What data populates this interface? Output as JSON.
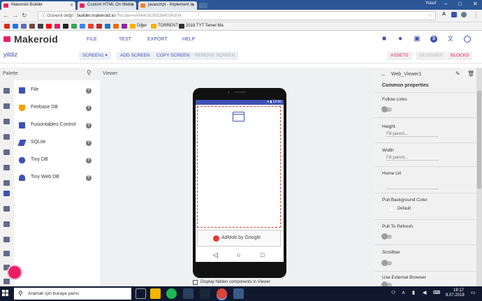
{
  "browser": {
    "tabs": [
      {
        "title": "Makeroid Builder",
        "favicon_color": "#e91e63",
        "active": true
      },
      {
        "title": "Custom HTML On Webvi",
        "favicon_color": "#e91e63",
        "active": false
      },
      {
        "title": "javascript - Implement la",
        "favicon_color": "#f48024",
        "active": false
      }
    ],
    "user": "Yusuf",
    "address": {
      "insecure_label": "Güvenli değil",
      "domain": "builder.makeroid.io",
      "path": "/?locale=en#6416265384034304"
    },
    "bookmarks": [
      {
        "label": "",
        "color": "#e3261c"
      },
      {
        "label": "",
        "color": "#1877f2"
      },
      {
        "label": "",
        "color": "#5c6bc0"
      },
      {
        "label": "",
        "color": "#6d4c41"
      },
      {
        "label": "",
        "color": "#424242"
      },
      {
        "label": "",
        "color": "#ff0000"
      },
      {
        "label": "",
        "color": "#e91e63"
      },
      {
        "label": "",
        "color": "#222222"
      },
      {
        "label": "",
        "color": "#34a853"
      },
      {
        "label": "",
        "color": "#4285f4"
      },
      {
        "label": "",
        "color": "#ea4335"
      },
      {
        "label": "",
        "color": "#c62828"
      },
      {
        "label": "",
        "color": "#1976d2"
      },
      {
        "label": "",
        "color": "#ef6c00"
      },
      {
        "label": "",
        "color": "#8e24aa"
      },
      {
        "label": "Diğer",
        "color": "#f4b400"
      },
      {
        "label": "TORRENT",
        "color": "#f4b400"
      },
      {
        "label": "2018 TYT Temel Ma",
        "color": "#333333"
      }
    ]
  },
  "app": {
    "brand": "Makeroid",
    "menu": [
      "FILE",
      "TEST",
      "EXPORT",
      "HELP"
    ],
    "project_name": "yildiz",
    "screen_button": "SCREEN1 ▾",
    "add_screen": "ADD SCREEN",
    "copy_screen": "COPY SCREEN",
    "remove_screen": "REMOVE SCREEN",
    "assets": "ASSETS",
    "designer": "DESIGNER",
    "blocks": "BLOCKS"
  },
  "palette": {
    "title": "Palette",
    "items": [
      {
        "label": "File",
        "icon": "file-icon",
        "color": "#3f51b5"
      },
      {
        "label": "Firebase DB",
        "icon": "firebase-icon",
        "color": "#ffa000"
      },
      {
        "label": "Fusiontables Control",
        "icon": "chart-icon",
        "color": "#3f51b5"
      },
      {
        "label": "SQLite",
        "icon": "feather-icon",
        "color": "#3f51b5"
      },
      {
        "label": "Tiny DB",
        "icon": "database-icon",
        "color": "#3f51b5"
      },
      {
        "label": "Tiny Web DB",
        "icon": "cloud-upload-icon",
        "color": "#3f51b5"
      }
    ],
    "help_glyph": "?"
  },
  "viewer": {
    "title": "Viewer",
    "status_time": "12:00",
    "admob_text": "AdMob by Google",
    "hidden_components_label": "Display hidden components in Viewer"
  },
  "properties": {
    "component_name": "Web_Viewer1",
    "section": "Common properties",
    "rows": [
      {
        "label": "Follow Links",
        "kind": "toggle"
      },
      {
        "label": "Height",
        "kind": "text",
        "value": "Fill parent..."
      },
      {
        "label": "Width",
        "kind": "text",
        "value": "Fill parent..."
      },
      {
        "label": "Home Url",
        "kind": "text",
        "value": ""
      },
      {
        "label": "Pull Background Color",
        "kind": "color",
        "value": "Default"
      },
      {
        "label": "Pull To Refresh",
        "kind": "toggle"
      },
      {
        "label": "Scrollbar",
        "kind": "toggle"
      },
      {
        "label": "Use External Browser",
        "kind": "toggle"
      }
    ]
  },
  "taskbar": {
    "search_placeholder": "Aramak için buraya yazın",
    "time": "18:17",
    "date": "8.07.2018"
  }
}
